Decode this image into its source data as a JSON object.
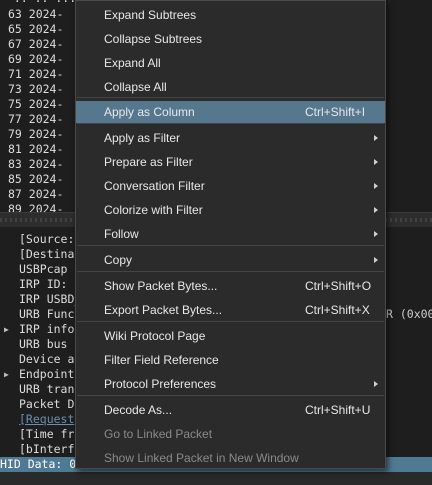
{
  "packet_list": {
    "rows": [
      {
        "no": "63",
        "text": "63 2024-"
      },
      {
        "no": "65",
        "text": "65 2024-"
      },
      {
        "no": "67",
        "text": "67 2024-"
      },
      {
        "no": "69",
        "text": "69 2024-"
      },
      {
        "no": "71",
        "text": "71 2024-"
      },
      {
        "no": "73",
        "text": "73 2024-"
      },
      {
        "no": "75",
        "text": "75 2024-"
      },
      {
        "no": "77",
        "text": "77 2024-"
      },
      {
        "no": "79",
        "text": "79 2024-"
      },
      {
        "no": "81",
        "text": "81 2024-"
      },
      {
        "no": "83",
        "text": "83 2024-"
      },
      {
        "no": "85",
        "text": "85 2024-"
      },
      {
        "no": "87",
        "text": "87 2024-"
      },
      {
        "no": "89",
        "text": "89 2024-"
      }
    ]
  },
  "details": {
    "rows": [
      {
        "text": "[Source:",
        "expandable": false,
        "link": false
      },
      {
        "text": "[Destina",
        "expandable": false,
        "link": false
      },
      {
        "text": "USBPcap",
        "expandable": false,
        "link": false
      },
      {
        "text": "IRP ID: 0",
        "expandable": false,
        "link": false
      },
      {
        "text": "IRP USBD_",
        "expandable": false,
        "link": false
      },
      {
        "text": "URB Func",
        "expandable": false,
        "link": false,
        "right": "R (0x00"
      },
      {
        "text": "IRP info",
        "expandable": true,
        "link": false
      },
      {
        "text": "URB bus",
        "expandable": false,
        "link": false
      },
      {
        "text": "Device a",
        "expandable": false,
        "link": false
      },
      {
        "text": "Endpoint",
        "expandable": true,
        "link": false
      },
      {
        "text": "URB tran",
        "expandable": false,
        "link": false
      },
      {
        "text": "Packet D",
        "expandable": false,
        "link": false
      },
      {
        "text": "[Request",
        "expandable": false,
        "link": true
      },
      {
        "text": "[Time fr",
        "expandable": false,
        "link": false
      },
      {
        "text": "[bInterf",
        "expandable": false,
        "link": false
      }
    ],
    "selected_row": "HID Data: 0"
  },
  "context_menu": {
    "items": [
      {
        "label": "Expand Subtrees",
        "shortcut": "",
        "submenu": false,
        "enabled": true
      },
      {
        "label": "Collapse Subtrees",
        "shortcut": "",
        "submenu": false,
        "enabled": true
      },
      {
        "label": "Expand All",
        "shortcut": "",
        "submenu": false,
        "enabled": true
      },
      {
        "label": "Collapse All",
        "shortcut": "",
        "submenu": false,
        "enabled": true
      },
      {
        "label": "Apply as Column",
        "shortcut": "Ctrl+Shift+I",
        "submenu": false,
        "enabled": true,
        "highlighted": true
      },
      {
        "label": "Apply as Filter",
        "shortcut": "",
        "submenu": true,
        "enabled": true
      },
      {
        "label": "Prepare as Filter",
        "shortcut": "",
        "submenu": true,
        "enabled": true
      },
      {
        "label": "Conversation Filter",
        "shortcut": "",
        "submenu": true,
        "enabled": true
      },
      {
        "label": "Colorize with Filter",
        "shortcut": "",
        "submenu": true,
        "enabled": true
      },
      {
        "label": "Follow",
        "shortcut": "",
        "submenu": true,
        "enabled": true
      },
      {
        "label": "Copy",
        "shortcut": "",
        "submenu": true,
        "enabled": true
      },
      {
        "label": "Show Packet Bytes...",
        "shortcut": "Ctrl+Shift+O",
        "submenu": false,
        "enabled": true
      },
      {
        "label": "Export Packet Bytes...",
        "shortcut": "Ctrl+Shift+X",
        "submenu": false,
        "enabled": true
      },
      {
        "label": "Wiki Protocol Page",
        "shortcut": "",
        "submenu": false,
        "enabled": true
      },
      {
        "label": "Filter Field Reference",
        "shortcut": "",
        "submenu": false,
        "enabled": true
      },
      {
        "label": "Protocol Preferences",
        "shortcut": "",
        "submenu": true,
        "enabled": true
      },
      {
        "label": "Decode As...",
        "shortcut": "Ctrl+Shift+U",
        "submenu": false,
        "enabled": true
      },
      {
        "label": "Go to Linked Packet",
        "shortcut": "",
        "submenu": false,
        "enabled": false
      },
      {
        "label": "Show Linked Packet in New Window",
        "shortcut": "",
        "submenu": false,
        "enabled": false
      }
    ]
  },
  "colors": {
    "highlight": "#56788e",
    "selected_row": "#4f7a94",
    "menu_bg": "#2b2b2b",
    "pane_bg": "#1e1e1e",
    "disabled_text": "#8a8a8a",
    "link_text": "#6b8fb3"
  }
}
